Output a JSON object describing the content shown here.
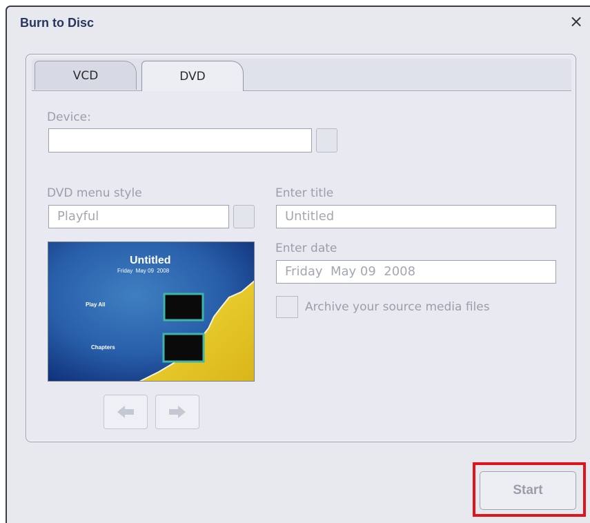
{
  "dialog": {
    "title": "Burn to Disc",
    "close_glyph": "×"
  },
  "tabs": [
    {
      "label": "VCD",
      "selected": false
    },
    {
      "label": "DVD",
      "selected": true
    }
  ],
  "device": {
    "label": "Device:",
    "value": ""
  },
  "menu_style": {
    "label": "DVD menu style",
    "value": "Playful"
  },
  "title_field": {
    "label": "Enter title",
    "value": "Untitled"
  },
  "date_field": {
    "label": "Enter date",
    "value": "Friday  May 09  2008"
  },
  "archive": {
    "label": "Archive your source media files",
    "checked": false
  },
  "preview": {
    "title": "Untitled",
    "date": "Friday  May 09  2008",
    "play_all": "Play All",
    "chapters": "Chapters"
  },
  "nav": {
    "prev_icon": "arrow-left-icon",
    "next_icon": "arrow-right-icon"
  },
  "start_label": "Start",
  "colors": {
    "highlight": "#e0141b",
    "title": "#28375f",
    "disabled_text": "#9a9ea9"
  }
}
